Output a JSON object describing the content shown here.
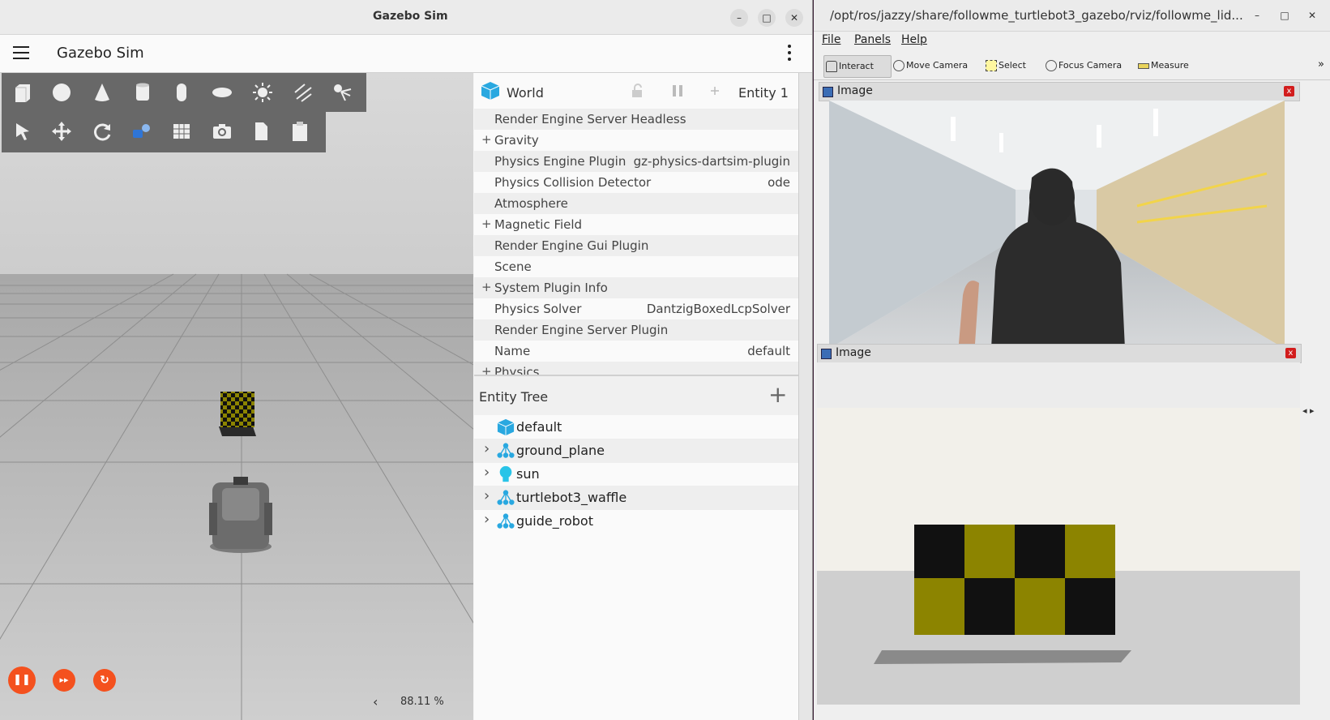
{
  "gazebo": {
    "window_title": "Gazebo Sim",
    "app_title": "Gazebo Sim",
    "zoom": "88.11 %",
    "zoom_arrow": "‹",
    "controls": {
      "pause": "❚❚",
      "step": "▸▸",
      "reset": "↻"
    },
    "world": {
      "label": "World",
      "entity": "Entity 1",
      "properties": [
        {
          "key": "Render Engine Server Headless",
          "value": "",
          "expandable": false
        },
        {
          "key": "Gravity",
          "value": "",
          "expandable": true
        },
        {
          "key": "Physics Engine Plugin",
          "value": "gz-physics-dartsim-plugin",
          "expandable": false
        },
        {
          "key": "Physics Collision Detector",
          "value": "ode",
          "expandable": false
        },
        {
          "key": "Atmosphere",
          "value": "",
          "expandable": false
        },
        {
          "key": "Magnetic Field",
          "value": "",
          "expandable": true
        },
        {
          "key": "Render Engine Gui Plugin",
          "value": "",
          "expandable": false
        },
        {
          "key": "Scene",
          "value": "",
          "expandable": false
        },
        {
          "key": "System Plugin Info",
          "value": "",
          "expandable": true
        },
        {
          "key": "Physics Solver",
          "value": "DantzigBoxedLcpSolver",
          "expandable": false
        },
        {
          "key": "Render Engine Server Plugin",
          "value": "",
          "expandable": false
        },
        {
          "key": "Name",
          "value": "default",
          "expandable": false
        },
        {
          "key": "Physics",
          "value": "",
          "expandable": true
        }
      ]
    },
    "entity_tree": {
      "label": "Entity Tree",
      "add": "+",
      "items": [
        {
          "name": "default",
          "icon": "world-cube-icon",
          "expandable": false
        },
        {
          "name": "ground_plane",
          "icon": "model-icon",
          "expandable": true
        },
        {
          "name": "sun",
          "icon": "light-bulb-icon",
          "expandable": true
        },
        {
          "name": "turtlebot3_waffle",
          "icon": "model-icon",
          "expandable": true
        },
        {
          "name": "guide_robot",
          "icon": "model-icon",
          "expandable": true
        }
      ]
    }
  },
  "rviz": {
    "window_title": "/opt/ros/jazzy/share/followme_turtlebot3_gazebo/rviz/followme_lid...",
    "menu": [
      "File",
      "Panels",
      "Help"
    ],
    "tools": [
      {
        "label": "Interact",
        "icon": "hand-icon",
        "active": true
      },
      {
        "label": "Move Camera",
        "icon": "move-camera-icon",
        "active": false
      },
      {
        "label": "Select",
        "icon": "select-icon",
        "active": false
      },
      {
        "label": "Focus Camera",
        "icon": "focus-camera-icon",
        "active": false
      },
      {
        "label": "Measure",
        "icon": "ruler-icon",
        "active": false
      }
    ],
    "more": "»",
    "displays": [
      {
        "title": "Image",
        "close": "x"
      },
      {
        "title": "Image",
        "close": "x"
      }
    ],
    "side_arrows": "◂ ▸"
  },
  "window_buttons": {
    "min": "–",
    "max": "□",
    "close": "✕"
  },
  "colors": {
    "accent": "#f4511e",
    "world_cube": "#29a8e0",
    "checker_yellow": "#8c8400"
  }
}
